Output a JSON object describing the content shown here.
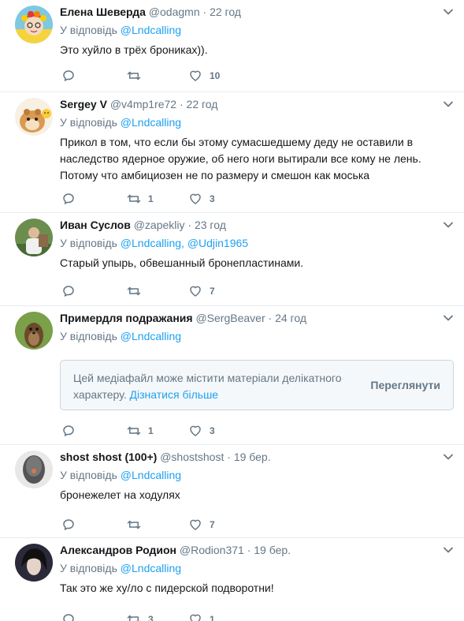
{
  "colors": {
    "accent": "#1da1f2",
    "secondary_text": "#657786",
    "border": "#e6ecf0"
  },
  "tweets": [
    {
      "name": "Елена Шеверда",
      "handle": "@odagmn",
      "time": "22 год",
      "reply_label": "У відповідь",
      "mentions": "@Lndcalling",
      "text": "Это хуйло в трёх брониках)).",
      "counts": {
        "reply": "",
        "retweet": "",
        "like": "10"
      },
      "avatar_icon": "avatar-flower-wreath"
    },
    {
      "name": "Sergey V",
      "handle": "@v4mp1re72",
      "time": "22 год",
      "reply_label": "У відповідь",
      "mentions": "@Lndcalling",
      "text": "Прикол в том, что если бы этому сумасшедшему деду не оставили в наследство ядерное оружие, об него ноги вытирали все кому не лень. Потому что амбициозен не по размеру и смешон как моська",
      "counts": {
        "reply": "",
        "retweet": "1",
        "like": "3"
      },
      "avatar_icon": "avatar-hamster"
    },
    {
      "name": "Иван Суслов",
      "handle": "@zapekliy",
      "time": "23 год",
      "reply_label": "У відповідь",
      "mentions": "@Lndcalling, @Udjin1965",
      "text": "Старый упырь, обвешанный бронепластинами.",
      "counts": {
        "reply": "",
        "retweet": "",
        "like": "7"
      },
      "avatar_icon": "avatar-man-outdoors"
    },
    {
      "name": "Примердля подражания",
      "handle": "@SergBeaver",
      "time": "24 год",
      "reply_label": "У відповідь",
      "mentions": "@Lndcalling",
      "media_warning": {
        "text": "Цей медіафайл може містити матеріали делікатного характеру.",
        "link": "Дізнатися більше",
        "button": "Переглянути"
      },
      "counts": {
        "reply": "",
        "retweet": "1",
        "like": "3"
      },
      "avatar_icon": "avatar-groundhog"
    },
    {
      "name": "shost shost (100+)",
      "handle": "@shostshost",
      "time": "19 бер.",
      "reply_label": "У відповідь",
      "mentions": "@Lndcalling",
      "text": "бронежелет на ходулях",
      "counts": {
        "reply": "",
        "retweet": "",
        "like": "7"
      },
      "avatar_icon": "avatar-egg"
    },
    {
      "name": "Александров Родион",
      "handle": "@Rodion371",
      "time": "19 бер.",
      "reply_label": "У відповідь",
      "mentions": "@Lndcalling",
      "text": "Так это же ху/ло с пидерской подворотни!",
      "counts": {
        "reply": "",
        "retweet": "3",
        "like": "1"
      },
      "avatar_icon": "avatar-dark-hair"
    }
  ]
}
